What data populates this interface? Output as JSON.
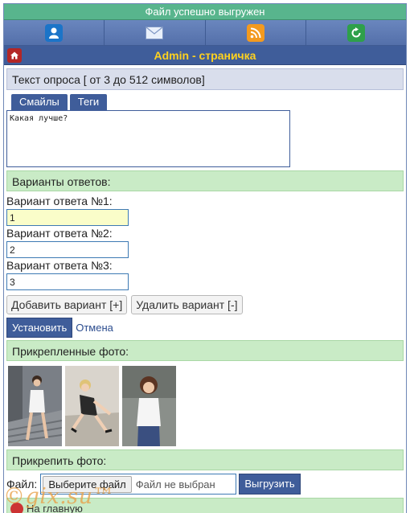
{
  "notice": "Файл успешно выгружен",
  "nav_icons": [
    "user-icon",
    "mail-icon",
    "rss-icon",
    "refresh-icon"
  ],
  "header": {
    "title": "Admin - страничка"
  },
  "poll": {
    "question_label": "Текст опроса [ от 3 до 512 символов]",
    "tabs": [
      "Смайлы",
      "Теги"
    ],
    "question_value": "Какая лучше?"
  },
  "answers": {
    "heading": "Варианты ответов:",
    "items": [
      {
        "label": "Вариант ответа №1:",
        "value": "1"
      },
      {
        "label": "Вариант ответа №2:",
        "value": "2"
      },
      {
        "label": "Вариант ответа №3:",
        "value": "3"
      }
    ],
    "add_label": "Добавить вариант [+]",
    "remove_label": "Удалить вариант [-]"
  },
  "actions": {
    "submit": "Установить",
    "cancel": "Отмена"
  },
  "attached": {
    "heading": "Прикрепленные фото:"
  },
  "attach": {
    "heading": "Прикрепить фото:",
    "file_label": "Файл:",
    "choose_button": "Выберите файл",
    "file_status": "Файл не выбран",
    "upload_button": "Выгрузить"
  },
  "footer": {
    "home_link": "На главную"
  },
  "watermark": "©gix.su™",
  "colors": {
    "accent": "#3f5d9a",
    "success": "#58b58d",
    "title_text": "#ffd21f",
    "section_green": "#c9ebc6"
  }
}
